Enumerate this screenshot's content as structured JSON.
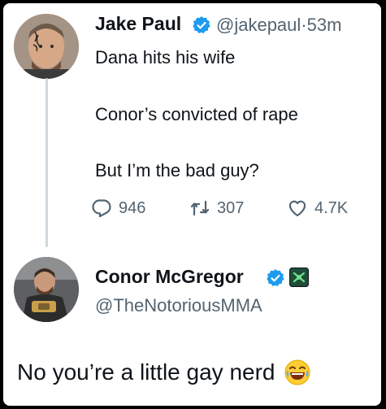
{
  "tweet": {
    "author_name": "Jake Paul",
    "handle": "@jakepaul",
    "separator": "·",
    "time": "53m",
    "lines": [
      "Dana hits his wife",
      "Conor’s convicted of rape",
      "But I’m the bad guy?"
    ],
    "actions": {
      "replies": "946",
      "reposts": "307",
      "likes": "4.7K"
    }
  },
  "reply": {
    "author_name": "Conor McGregor",
    "handle": "@TheNotoriousMMA",
    "text": "No you’re a little gay nerd"
  },
  "icons": {
    "verified": "verified-badge-icon",
    "reply": "comment-icon",
    "repost": "repost-icon",
    "like": "heart-icon",
    "affiliate": "affiliate-badge-icon",
    "emoji": "laughing-emoji-icon"
  },
  "colors": {
    "verified_blue": "#1d9bf0",
    "text": "#0f1419",
    "secondary": "#536471",
    "affiliate_bg": "#1f4d3a"
  }
}
